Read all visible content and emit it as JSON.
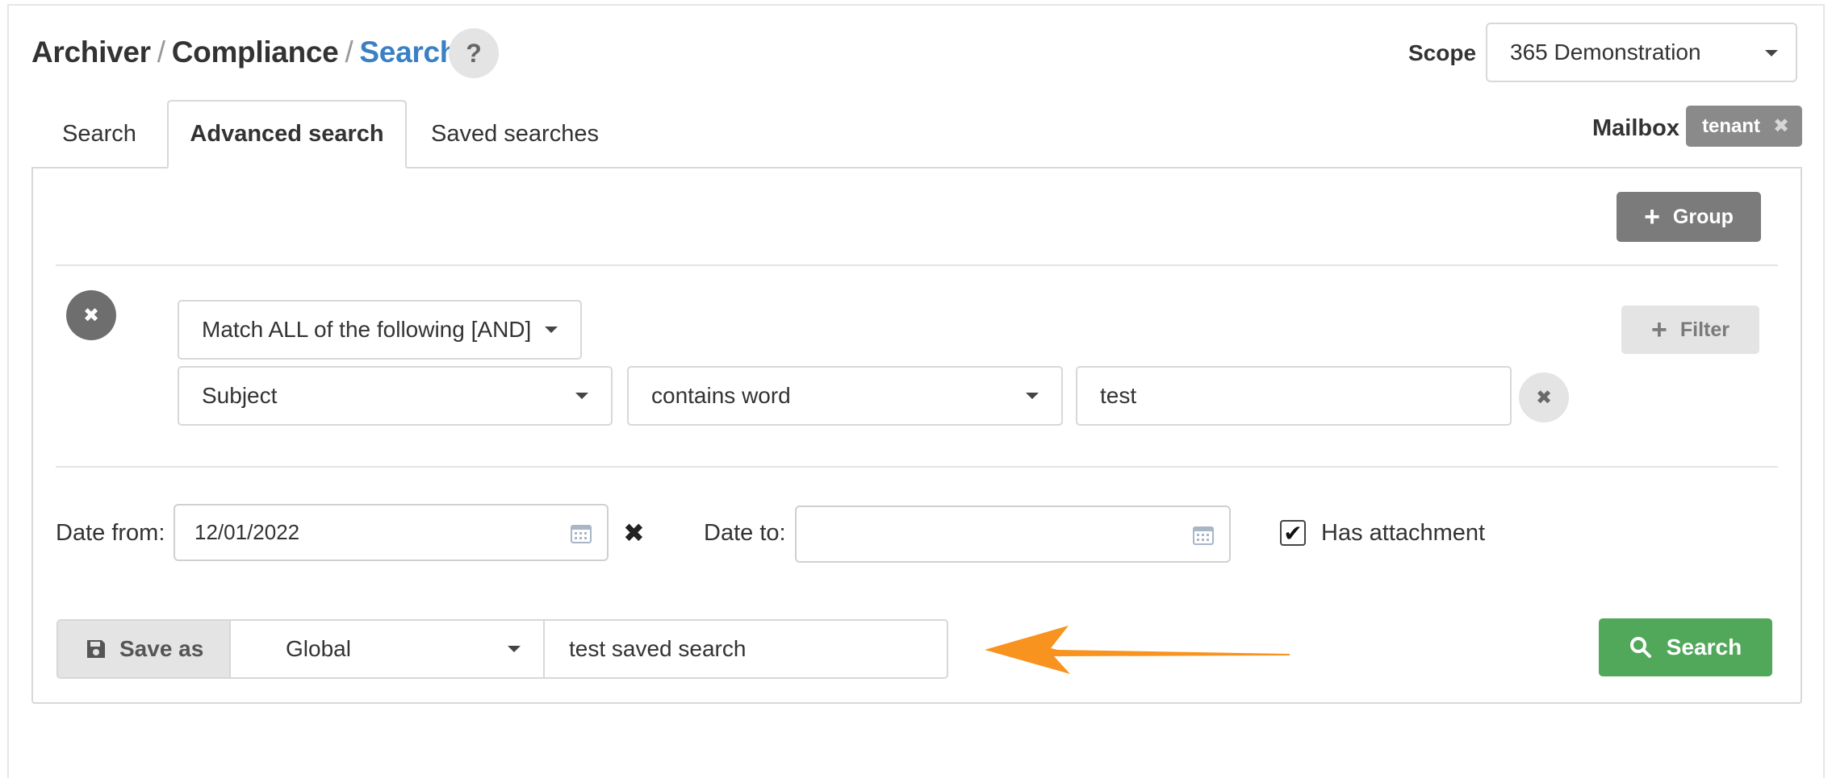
{
  "breadcrumb": {
    "part1": "Archiver",
    "part2": "Compliance",
    "part3": "Search",
    "separator": "/"
  },
  "help_label": "?",
  "scope": {
    "label": "Scope",
    "value": "365 Demonstration"
  },
  "mailbox": {
    "label": "Mailbox",
    "tag": "tenant",
    "remove_glyph": "✖"
  },
  "tabs": [
    {
      "label": "Search"
    },
    {
      "label": "Advanced search",
      "active": true
    },
    {
      "label": "Saved searches"
    }
  ],
  "group_button": {
    "label": "Group",
    "icon": "plus-icon"
  },
  "filter_button": {
    "label": "Filter",
    "icon": "plus-icon"
  },
  "remove_glyph": "✖",
  "match_select": {
    "value": "Match ALL of the following [AND]"
  },
  "condition": {
    "field": "Subject",
    "operator": "contains word",
    "value": "test"
  },
  "date_from": {
    "label": "Date from:",
    "value": "12/01/2022"
  },
  "date_to": {
    "label": "Date to:",
    "value": ""
  },
  "has_attachment": {
    "label": "Has attachment",
    "checked": true,
    "check_glyph": "✔"
  },
  "save_as": {
    "label": "Save as",
    "icon": "floppy-disk-icon",
    "scope": "Global",
    "name": "test saved search"
  },
  "search_button": {
    "label": "Search",
    "icon": "magnifier-icon"
  },
  "colors": {
    "link": "#3a80c4",
    "success": "#52a85a",
    "arrow": "#f7931e",
    "dark_button": "#7b7b7b"
  }
}
